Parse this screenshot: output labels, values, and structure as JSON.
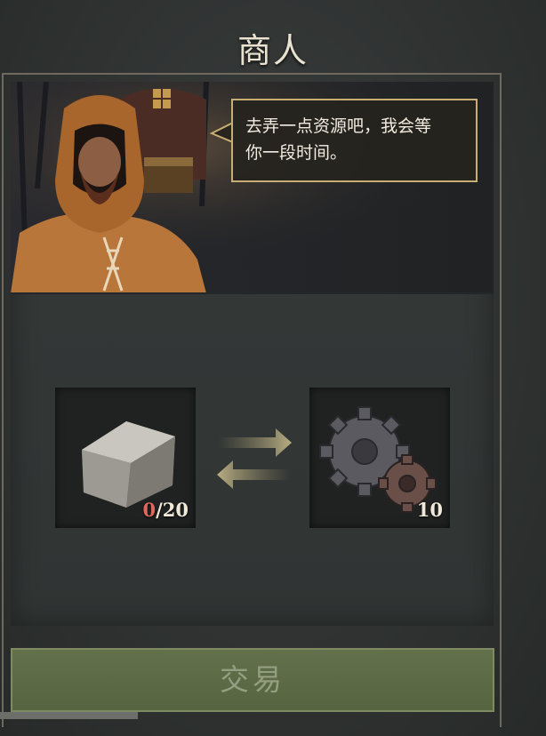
{
  "screen": {
    "title": "商人"
  },
  "merchant": {
    "speech": [
      "去弄一点资源吧，我会等",
      "你一段时间。"
    ]
  },
  "trade": {
    "give": {
      "icon": "stone-block-icon",
      "have": "0",
      "need": "/20"
    },
    "receive": {
      "icon": "gears-icon",
      "amount": "10"
    },
    "exchange_icon": "exchange-arrows-icon"
  },
  "button": {
    "label": "交易"
  },
  "colors": {
    "accent_gold": "#c8ae74",
    "button_green": "#5d6b46",
    "insufficient_red": "#e0675e"
  }
}
